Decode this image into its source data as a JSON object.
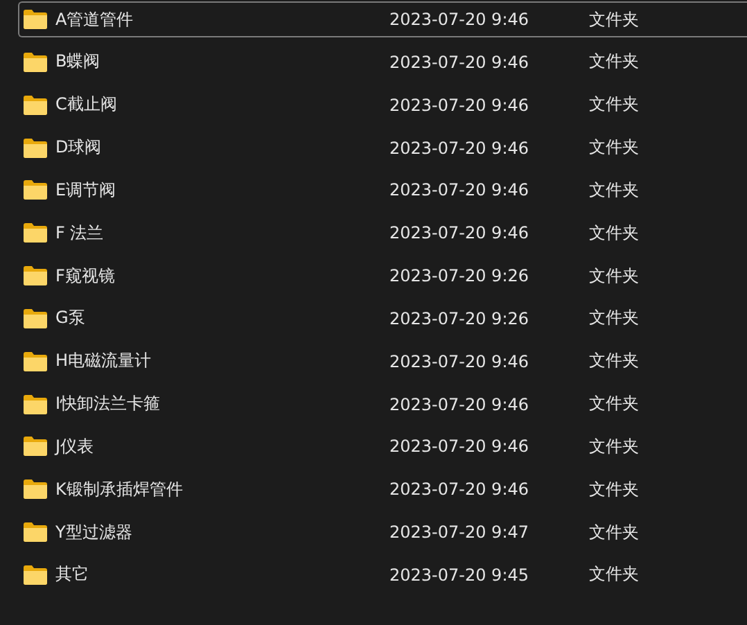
{
  "files": [
    {
      "name": "A管道管件",
      "modified": "2023-07-20 9:46",
      "type": "文件夹",
      "focused": true
    },
    {
      "name": "B蝶阀",
      "modified": "2023-07-20 9:46",
      "type": "文件夹",
      "focused": false
    },
    {
      "name": "C截止阀",
      "modified": "2023-07-20 9:46",
      "type": "文件夹",
      "focused": false
    },
    {
      "name": "D球阀",
      "modified": "2023-07-20 9:46",
      "type": "文件夹",
      "focused": false
    },
    {
      "name": "E调节阀",
      "modified": "2023-07-20 9:46",
      "type": "文件夹",
      "focused": false
    },
    {
      "name": "F 法兰",
      "modified": "2023-07-20 9:46",
      "type": "文件夹",
      "focused": false
    },
    {
      "name": "F窥视镜",
      "modified": "2023-07-20 9:26",
      "type": "文件夹",
      "focused": false
    },
    {
      "name": "G泵",
      "modified": "2023-07-20 9:26",
      "type": "文件夹",
      "focused": false
    },
    {
      "name": "H电磁流量计",
      "modified": "2023-07-20 9:46",
      "type": "文件夹",
      "focused": false
    },
    {
      "name": "I快卸法兰卡箍",
      "modified": "2023-07-20 9:46",
      "type": "文件夹",
      "focused": false
    },
    {
      "name": "J仪表",
      "modified": "2023-07-20 9:46",
      "type": "文件夹",
      "focused": false
    },
    {
      "name": "K锻制承插焊管件",
      "modified": "2023-07-20 9:46",
      "type": "文件夹",
      "focused": false
    },
    {
      "name": "Y型过滤器",
      "modified": "2023-07-20 9:47",
      "type": "文件夹",
      "focused": false
    },
    {
      "name": "其它",
      "modified": "2023-07-20 9:45",
      "type": "文件夹",
      "focused": false
    }
  ]
}
